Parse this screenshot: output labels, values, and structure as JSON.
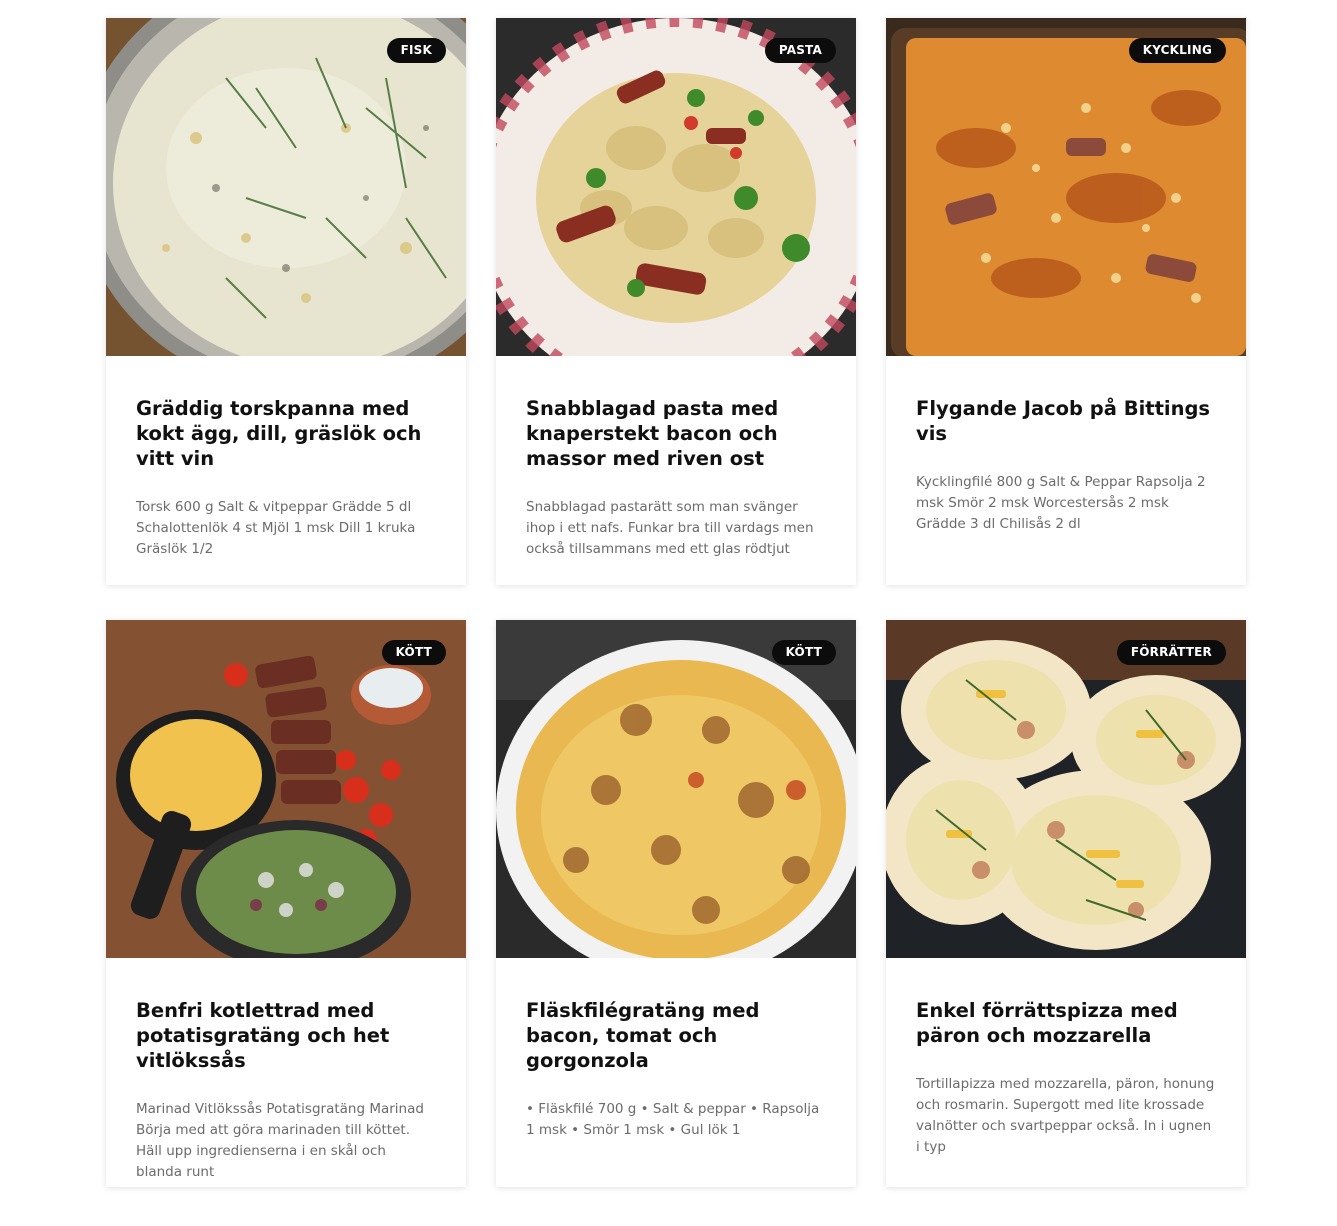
{
  "recipes": [
    {
      "category": "FISK",
      "title": "Gräddig torskpanna med kokt ägg, dill, gräslök och vitt vin",
      "excerpt": "Torsk 600 g  Salt & vitpeppar  Grädde 5 dl Schalottenlök 4 st Mjöl 1 msk  Dill 1 kruka Gräslök 1/2"
    },
    {
      "category": "PASTA",
      "title": "Snabblagad pasta med knaperstekt bacon och massor med riven ost",
      "excerpt": "Snabblagad pastarätt som man svänger ihop i ett nafs. Funkar bra till vardags men också tillsammans med ett glas rödtjut"
    },
    {
      "category": "KYCKLING",
      "title": "Flygande Jacob på Bittings vis",
      "excerpt": "Kycklingfilé 800 g  Salt & Peppar  Rapsolja 2 msk  Smör 2 msk  Worcestersås 2 msk Grädde 3 dl  Chilisås 2 dl"
    },
    {
      "category": "KÖTT",
      "title": "Benfri kotlettrad med potatisgratäng och het vitlökssås",
      "excerpt": "Marinad  Vitlökssås Potatisgratäng  Marinad Börja med att göra marinaden till köttet. Häll upp ingredienserna i en skål och blanda runt"
    },
    {
      "category": "KÖTT",
      "title": "Fläskfilégratäng med bacon, tomat och gorgonzola",
      "excerpt": "• Fläskfilé 700 g • Salt & peppar • Rapsolja 1 msk • Smör 1 msk • Gul lök 1"
    },
    {
      "category": "FÖRRÄTTER",
      "title": "Enkel förrättspizza med päron och mozzarella",
      "excerpt": "Tortillapizza med mozzarella, päron, honung och rosmarin. Supergott med lite krossade valnötter och svartpeppar också. In i ugnen i typ"
    }
  ]
}
